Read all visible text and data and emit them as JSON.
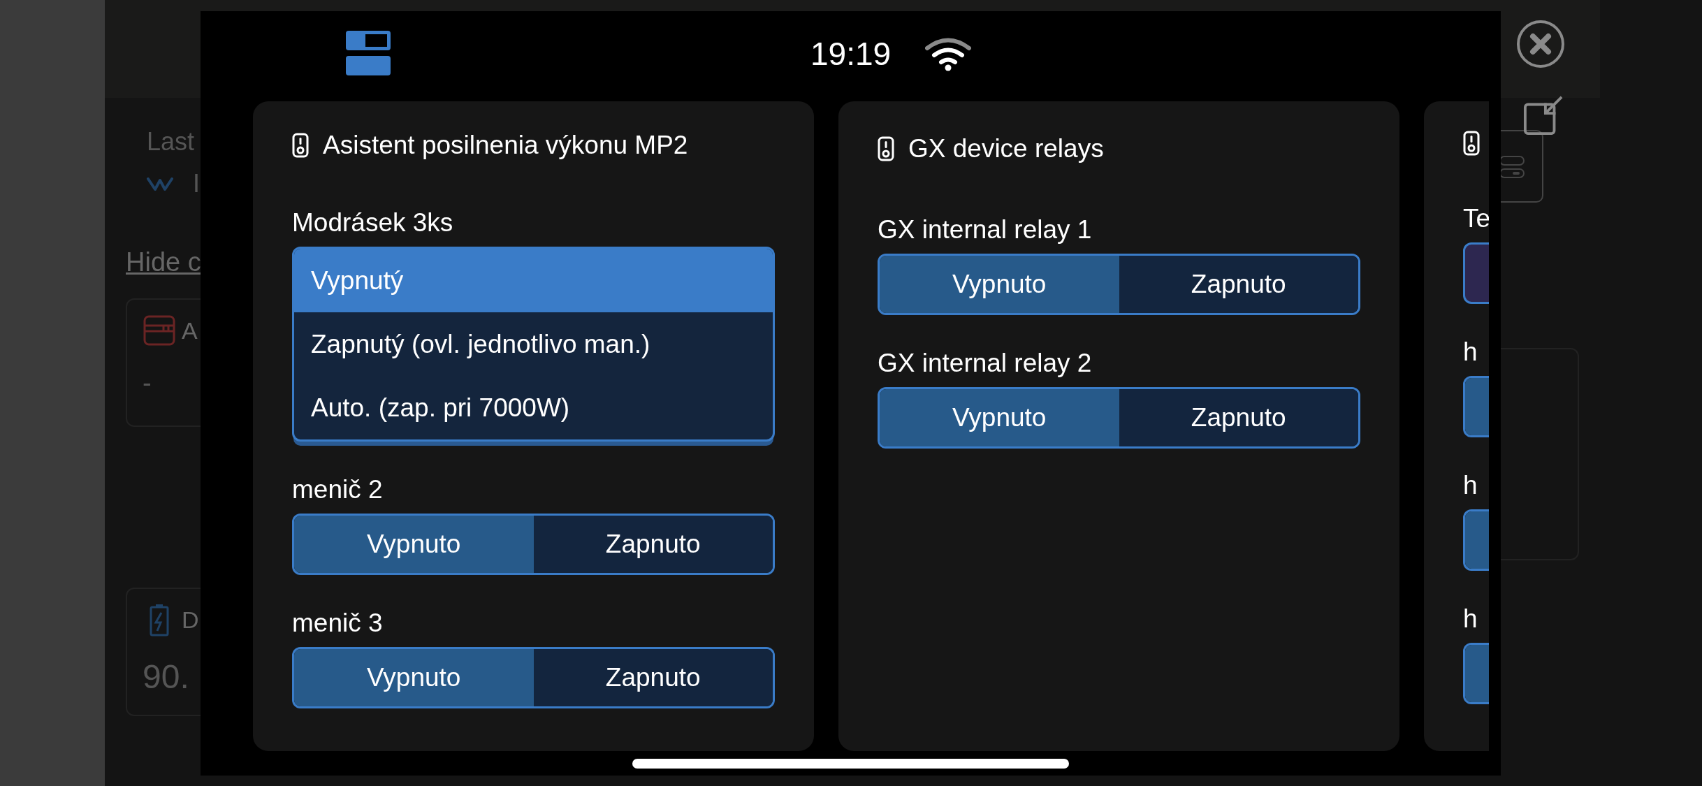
{
  "background": {
    "last_label": "Last",
    "status_text": "I",
    "hide_link": "Hide c",
    "cards": [
      {
        "kind": "alarm",
        "title": "A",
        "value": "-"
      },
      {
        "kind": "battery",
        "title": "D",
        "value": "90."
      }
    ]
  },
  "status_bar": {
    "time": "19:19"
  },
  "panels": [
    {
      "title": "Asistent posilnenia výkonu MP2",
      "fields": [
        {
          "label": "Modrásek 3ks",
          "kind": "dropdown",
          "open": true,
          "options": [
            {
              "label": "Vypnutý",
              "selected": true
            },
            {
              "label": "Zapnutý (ovl. jednotlivo man.)",
              "selected": false
            },
            {
              "label": "Auto. (zap. pri 7000W)",
              "selected": false
            }
          ]
        },
        {
          "label": "menič 2",
          "kind": "segmented",
          "options": [
            {
              "label": "Vypnuto",
              "selected": true
            },
            {
              "label": "Zapnuto",
              "selected": false
            }
          ]
        },
        {
          "label": "menič 3",
          "kind": "segmented",
          "options": [
            {
              "label": "Vypnuto",
              "selected": true
            },
            {
              "label": "Zapnuto",
              "selected": false
            }
          ]
        }
      ]
    },
    {
      "title": "GX device relays",
      "fields": [
        {
          "label": "GX internal relay 1",
          "kind": "segmented",
          "options": [
            {
              "label": "Vypnuto",
              "selected": true
            },
            {
              "label": "Zapnuto",
              "selected": false
            }
          ]
        },
        {
          "label": "GX internal relay 2",
          "kind": "segmented",
          "options": [
            {
              "label": "Vypnuto",
              "selected": true
            },
            {
              "label": "Zapnuto",
              "selected": false
            }
          ]
        }
      ]
    },
    {
      "fields": [
        {
          "label": "Te",
          "kind": "dropdown",
          "open": false
        },
        {
          "label": "h",
          "kind": "segmented",
          "options": [
            {
              "selected": true
            }
          ]
        },
        {
          "label": "h",
          "kind": "segmented",
          "options": [
            {
              "selected": true
            }
          ]
        },
        {
          "label": "h",
          "kind": "segmented",
          "options": [
            {
              "selected": true
            }
          ]
        }
      ]
    }
  ]
}
